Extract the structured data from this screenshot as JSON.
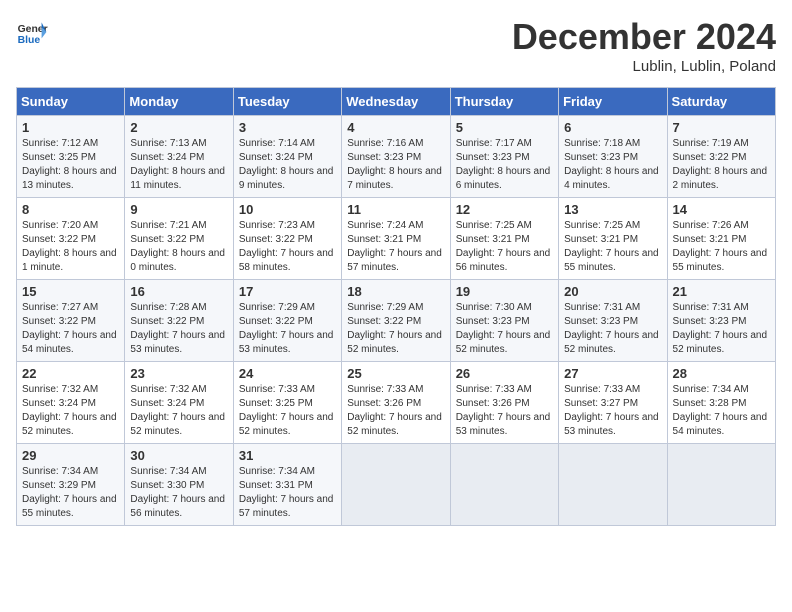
{
  "header": {
    "logo_general": "General",
    "logo_blue": "Blue",
    "month_title": "December 2024",
    "subtitle": "Lublin, Lublin, Poland"
  },
  "days_of_week": [
    "Sunday",
    "Monday",
    "Tuesday",
    "Wednesday",
    "Thursday",
    "Friday",
    "Saturday"
  ],
  "weeks": [
    [
      {
        "day": "1",
        "sunrise": "Sunrise: 7:12 AM",
        "sunset": "Sunset: 3:25 PM",
        "daylight": "Daylight: 8 hours and 13 minutes."
      },
      {
        "day": "2",
        "sunrise": "Sunrise: 7:13 AM",
        "sunset": "Sunset: 3:24 PM",
        "daylight": "Daylight: 8 hours and 11 minutes."
      },
      {
        "day": "3",
        "sunrise": "Sunrise: 7:14 AM",
        "sunset": "Sunset: 3:24 PM",
        "daylight": "Daylight: 8 hours and 9 minutes."
      },
      {
        "day": "4",
        "sunrise": "Sunrise: 7:16 AM",
        "sunset": "Sunset: 3:23 PM",
        "daylight": "Daylight: 8 hours and 7 minutes."
      },
      {
        "day": "5",
        "sunrise": "Sunrise: 7:17 AM",
        "sunset": "Sunset: 3:23 PM",
        "daylight": "Daylight: 8 hours and 6 minutes."
      },
      {
        "day": "6",
        "sunrise": "Sunrise: 7:18 AM",
        "sunset": "Sunset: 3:23 PM",
        "daylight": "Daylight: 8 hours and 4 minutes."
      },
      {
        "day": "7",
        "sunrise": "Sunrise: 7:19 AM",
        "sunset": "Sunset: 3:22 PM",
        "daylight": "Daylight: 8 hours and 2 minutes."
      }
    ],
    [
      {
        "day": "8",
        "sunrise": "Sunrise: 7:20 AM",
        "sunset": "Sunset: 3:22 PM",
        "daylight": "Daylight: 8 hours and 1 minute."
      },
      {
        "day": "9",
        "sunrise": "Sunrise: 7:21 AM",
        "sunset": "Sunset: 3:22 PM",
        "daylight": "Daylight: 8 hours and 0 minutes."
      },
      {
        "day": "10",
        "sunrise": "Sunrise: 7:23 AM",
        "sunset": "Sunset: 3:22 PM",
        "daylight": "Daylight: 7 hours and 58 minutes."
      },
      {
        "day": "11",
        "sunrise": "Sunrise: 7:24 AM",
        "sunset": "Sunset: 3:21 PM",
        "daylight": "Daylight: 7 hours and 57 minutes."
      },
      {
        "day": "12",
        "sunrise": "Sunrise: 7:25 AM",
        "sunset": "Sunset: 3:21 PM",
        "daylight": "Daylight: 7 hours and 56 minutes."
      },
      {
        "day": "13",
        "sunrise": "Sunrise: 7:25 AM",
        "sunset": "Sunset: 3:21 PM",
        "daylight": "Daylight: 7 hours and 55 minutes."
      },
      {
        "day": "14",
        "sunrise": "Sunrise: 7:26 AM",
        "sunset": "Sunset: 3:21 PM",
        "daylight": "Daylight: 7 hours and 55 minutes."
      }
    ],
    [
      {
        "day": "15",
        "sunrise": "Sunrise: 7:27 AM",
        "sunset": "Sunset: 3:22 PM",
        "daylight": "Daylight: 7 hours and 54 minutes."
      },
      {
        "day": "16",
        "sunrise": "Sunrise: 7:28 AM",
        "sunset": "Sunset: 3:22 PM",
        "daylight": "Daylight: 7 hours and 53 minutes."
      },
      {
        "day": "17",
        "sunrise": "Sunrise: 7:29 AM",
        "sunset": "Sunset: 3:22 PM",
        "daylight": "Daylight: 7 hours and 53 minutes."
      },
      {
        "day": "18",
        "sunrise": "Sunrise: 7:29 AM",
        "sunset": "Sunset: 3:22 PM",
        "daylight": "Daylight: 7 hours and 52 minutes."
      },
      {
        "day": "19",
        "sunrise": "Sunrise: 7:30 AM",
        "sunset": "Sunset: 3:23 PM",
        "daylight": "Daylight: 7 hours and 52 minutes."
      },
      {
        "day": "20",
        "sunrise": "Sunrise: 7:31 AM",
        "sunset": "Sunset: 3:23 PM",
        "daylight": "Daylight: 7 hours and 52 minutes."
      },
      {
        "day": "21",
        "sunrise": "Sunrise: 7:31 AM",
        "sunset": "Sunset: 3:23 PM",
        "daylight": "Daylight: 7 hours and 52 minutes."
      }
    ],
    [
      {
        "day": "22",
        "sunrise": "Sunrise: 7:32 AM",
        "sunset": "Sunset: 3:24 PM",
        "daylight": "Daylight: 7 hours and 52 minutes."
      },
      {
        "day": "23",
        "sunrise": "Sunrise: 7:32 AM",
        "sunset": "Sunset: 3:24 PM",
        "daylight": "Daylight: 7 hours and 52 minutes."
      },
      {
        "day": "24",
        "sunrise": "Sunrise: 7:33 AM",
        "sunset": "Sunset: 3:25 PM",
        "daylight": "Daylight: 7 hours and 52 minutes."
      },
      {
        "day": "25",
        "sunrise": "Sunrise: 7:33 AM",
        "sunset": "Sunset: 3:26 PM",
        "daylight": "Daylight: 7 hours and 52 minutes."
      },
      {
        "day": "26",
        "sunrise": "Sunrise: 7:33 AM",
        "sunset": "Sunset: 3:26 PM",
        "daylight": "Daylight: 7 hours and 53 minutes."
      },
      {
        "day": "27",
        "sunrise": "Sunrise: 7:33 AM",
        "sunset": "Sunset: 3:27 PM",
        "daylight": "Daylight: 7 hours and 53 minutes."
      },
      {
        "day": "28",
        "sunrise": "Sunrise: 7:34 AM",
        "sunset": "Sunset: 3:28 PM",
        "daylight": "Daylight: 7 hours and 54 minutes."
      }
    ],
    [
      {
        "day": "29",
        "sunrise": "Sunrise: 7:34 AM",
        "sunset": "Sunset: 3:29 PM",
        "daylight": "Daylight: 7 hours and 55 minutes."
      },
      {
        "day": "30",
        "sunrise": "Sunrise: 7:34 AM",
        "sunset": "Sunset: 3:30 PM",
        "daylight": "Daylight: 7 hours and 56 minutes."
      },
      {
        "day": "31",
        "sunrise": "Sunrise: 7:34 AM",
        "sunset": "Sunset: 3:31 PM",
        "daylight": "Daylight: 7 hours and 57 minutes."
      },
      null,
      null,
      null,
      null
    ]
  ]
}
